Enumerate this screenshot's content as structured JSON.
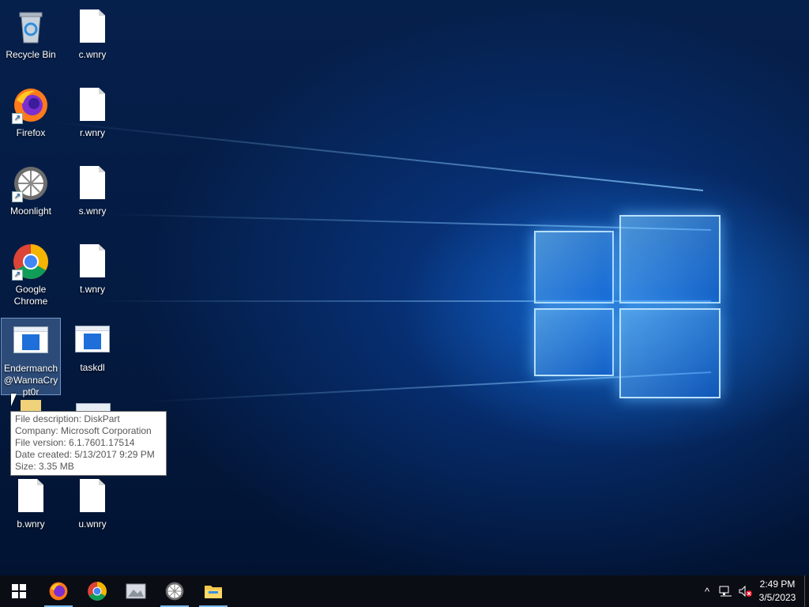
{
  "desktop": {
    "icons": [
      {
        "label": "Recycle Bin",
        "icon": "recycle-bin-icon"
      },
      {
        "label": "c.wnry",
        "icon": "file-icon"
      },
      {
        "label": "Firefox",
        "icon": "firefox-icon"
      },
      {
        "label": "r.wnry",
        "icon": "file-icon"
      },
      {
        "label": "Moonlight",
        "icon": "moonlight-icon"
      },
      {
        "label": "s.wnry",
        "icon": "file-icon"
      },
      {
        "label": "Google Chrome",
        "icon": "chrome-icon"
      },
      {
        "label": "t.wnry",
        "icon": "file-icon"
      },
      {
        "label": "Endermanch@WannaCrypt0r",
        "icon": "application-icon"
      },
      {
        "label": "taskdl",
        "icon": "application-icon"
      },
      {
        "label": "b.wnry",
        "icon": "file-icon"
      },
      {
        "label": "u.wnry",
        "icon": "file-icon"
      }
    ]
  },
  "tooltip": {
    "line1": "File description: DiskPart",
    "line2": "Company: Microsoft Corporation",
    "line3": "File version: 6.1.7601.17514",
    "line4": "Date created: 5/13/2017 9:29 PM",
    "line5": "Size: 3.35 MB"
  },
  "taskbar": {
    "apps": [
      "start-icon",
      "firefox-icon",
      "chrome-icon",
      "photos-icon",
      "moonlight-icon",
      "file-explorer-icon"
    ],
    "tray": {
      "chevron": "^",
      "time": "2:49 PM",
      "date": "3/5/2023"
    }
  },
  "colors": {
    "accent": "#76b9ed",
    "taskbar": "#0b0d14",
    "wallpaper": "#041b42"
  }
}
